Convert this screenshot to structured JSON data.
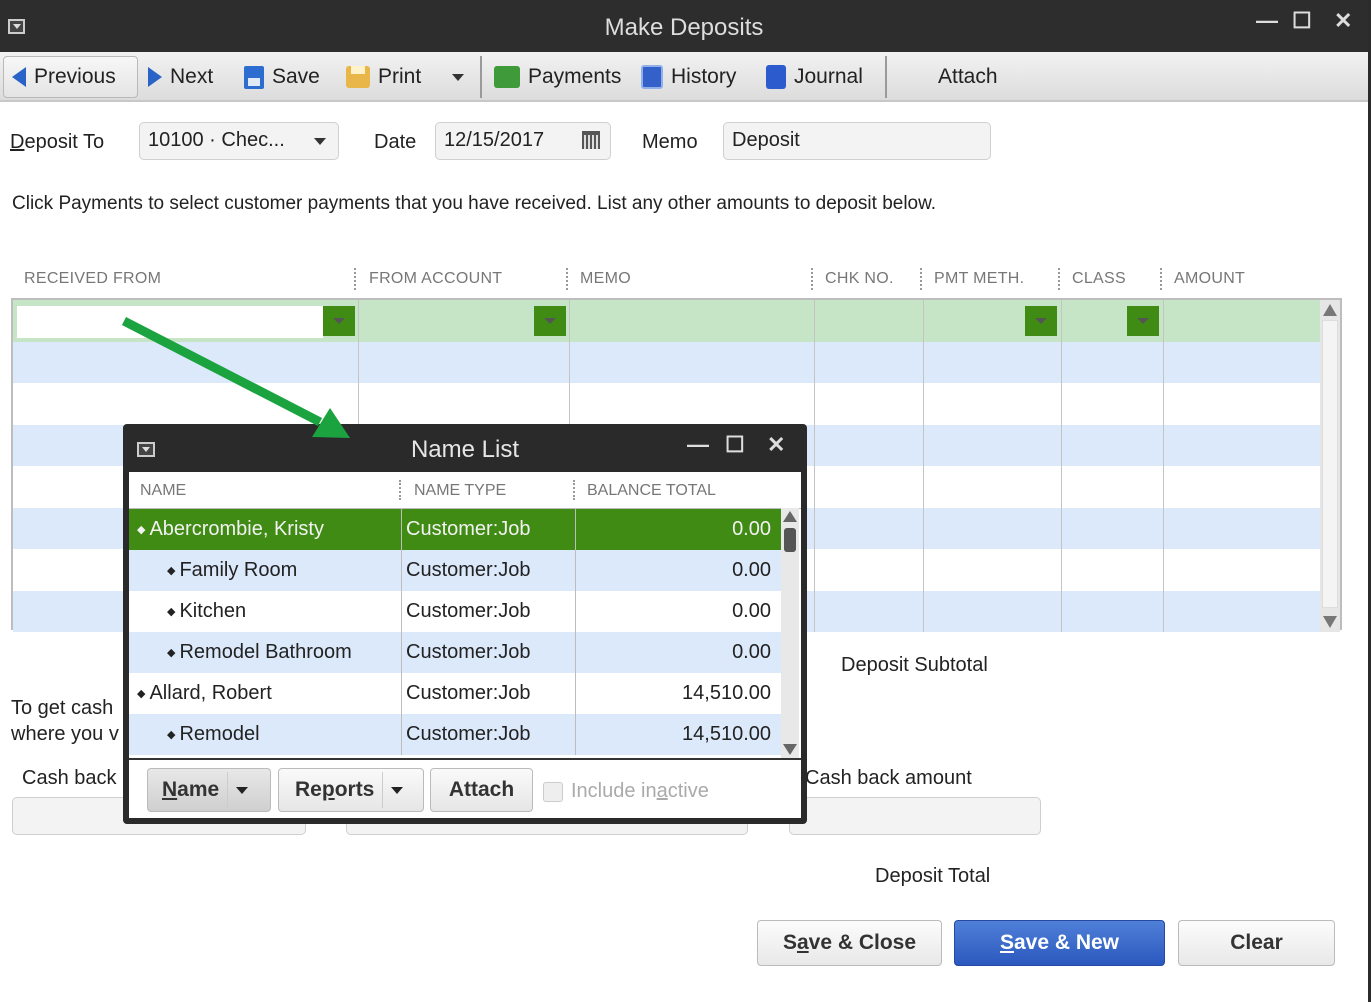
{
  "window": {
    "title": "Make Deposits",
    "controls": {
      "minimize": "—",
      "maximize": "☐",
      "close": "✕"
    }
  },
  "toolbar": {
    "previous": "Previous",
    "next": "Next",
    "save": "Save",
    "print": "Print",
    "payments": "Payments",
    "history": "History",
    "journal": "Journal",
    "attach": "Attach"
  },
  "form": {
    "deposit_to_label_u": "D",
    "deposit_to_label_rest": "eposit To",
    "deposit_to_value": "10100 · Chec...",
    "date_label": "Date",
    "date_value": "12/15/2017",
    "memo_label": "Memo",
    "memo_value": "Deposit",
    "instructions": "Click Payments to select customer payments that you have received. List any other amounts to deposit below."
  },
  "grid": {
    "columns": [
      "RECEIVED FROM",
      "FROM ACCOUNT",
      "MEMO",
      "CHK NO.",
      "PMT METH.",
      "CLASS",
      "AMOUNT"
    ],
    "rows": [
      {
        "received_from": "",
        "from_account": "",
        "memo": "",
        "chk_no": "",
        "pmt_meth": "",
        "class": "",
        "amount": ""
      }
    ]
  },
  "totals": {
    "deposit_subtotal_label": "Deposit Subtotal",
    "cash_back_text_line1": "To get cash",
    "cash_back_text_line2": "where you v",
    "cash_back_goes_to_label": "Cash back",
    "cash_back_amount_label": "Cash back amount",
    "deposit_total_label": "Deposit Total"
  },
  "buttons": {
    "save_close_pre": "S",
    "save_close_u": "a",
    "save_close_post": "ve & Close",
    "save_new_u": "S",
    "save_new_post": "ave & New",
    "clear": "Clear"
  },
  "name_list": {
    "title": "Name List",
    "columns": [
      "NAME",
      "NAME TYPE",
      "BALANCE TOTAL"
    ],
    "rows": [
      {
        "name": "Abercrombie, Kristy",
        "type": "Customer:Job",
        "balance": "0.00",
        "level": 0,
        "selected": true
      },
      {
        "name": "Family Room",
        "type": "Customer:Job",
        "balance": "0.00",
        "level": 1,
        "selected": false
      },
      {
        "name": "Kitchen",
        "type": "Customer:Job",
        "balance": "0.00",
        "level": 1,
        "selected": false
      },
      {
        "name": "Remodel Bathroom",
        "type": "Customer:Job",
        "balance": "0.00",
        "level": 1,
        "selected": false
      },
      {
        "name": "Allard, Robert",
        "type": "Customer:Job",
        "balance": "14,510.00",
        "level": 0,
        "selected": false
      },
      {
        "name": "Remodel",
        "type": "Customer:Job",
        "balance": "14,510.00",
        "level": 1,
        "selected": false
      }
    ],
    "footer": {
      "name_u": "N",
      "name_rest": "ame",
      "reports_pre": "Re",
      "reports_u": "p",
      "reports_post": "orts",
      "attach": "Attach",
      "include_inactive_pre": "Include in",
      "include_inactive_u": "a",
      "include_inactive_post": "ctive",
      "include_inactive_checked": false
    }
  },
  "colors": {
    "selected_row": "#3f8b14",
    "active_grid_row": "#c6e5c7",
    "stripe_row": "#dbe9fb",
    "primary_button": "#2b58be",
    "annotation_arrow": "#1aa33f"
  }
}
